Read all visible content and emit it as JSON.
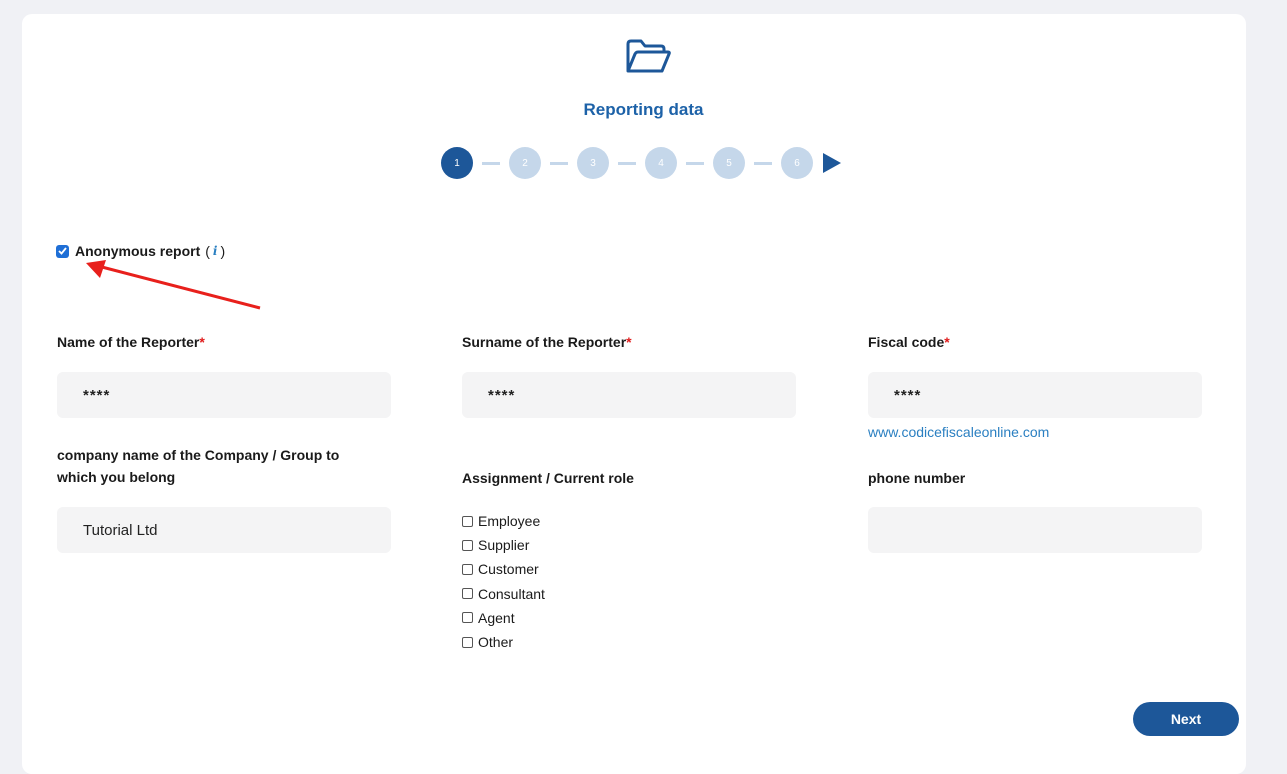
{
  "header": {
    "title": "Reporting data"
  },
  "stepper": {
    "steps": [
      "1",
      "2",
      "3",
      "4",
      "5",
      "6"
    ],
    "current": 1
  },
  "anonymous": {
    "label": "Anonymous report",
    "checked": true,
    "open_paren": "(",
    "info_glyph": "i",
    "close_paren": ")"
  },
  "fields": {
    "name": {
      "label": "Name of the Reporter",
      "required_mark": "*",
      "value": "****"
    },
    "surname": {
      "label": "Surname of the Reporter",
      "required_mark": "*",
      "value": "****"
    },
    "fiscal": {
      "label": "Fiscal code",
      "required_mark": "*",
      "value": "****",
      "link": "www.codicefiscaleonline.com"
    },
    "company": {
      "label_line1": "company name of the Company / Group to",
      "label_line2": "which you belong",
      "value": "Tutorial Ltd"
    },
    "role": {
      "label": "Assignment / Current role",
      "options": [
        "Employee",
        "Supplier",
        "Customer",
        "Consultant",
        "Agent",
        "Other"
      ]
    },
    "phone": {
      "label": "phone number",
      "value": ""
    }
  },
  "actions": {
    "next_label": "Next"
  },
  "colors": {
    "accent": "#1d5799",
    "step_inactive": "#c5d7ea",
    "required": "#e01b1b",
    "link": "#2a7fc1",
    "annotation_arrow": "#e8201c"
  }
}
